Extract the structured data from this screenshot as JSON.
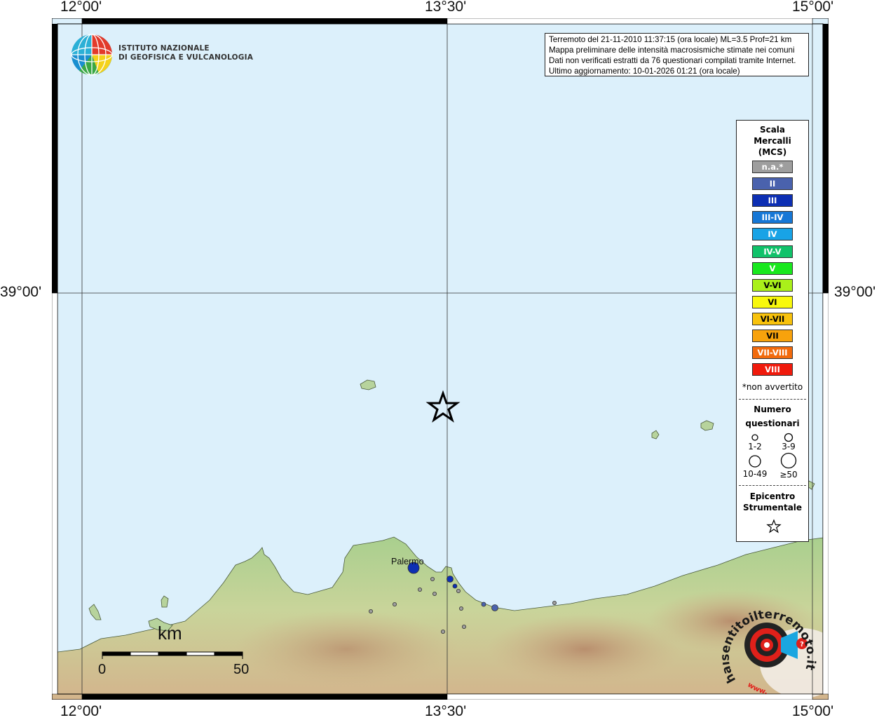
{
  "coords": {
    "top": [
      "12°00'",
      "13°30'",
      "15°00'"
    ],
    "bottom": [
      "12°00'",
      "13°30'",
      "15°00'"
    ],
    "left": "39°00'",
    "right": "39°00'"
  },
  "logo": {
    "line1": "ISTITUTO NAZIONALE",
    "line2": "DI GEOFISICA E VULCANOLOGIA"
  },
  "info": [
    "Terremoto del 21-11-2010 11:37:15 (ora locale) ML=3.5 Prof=21 km",
    "Mappa preliminare delle intensità macrosismiche stimate nei comuni",
    "Dati non verificati estratti da 76 questionari compilati tramite Internet.",
    "Ultimo aggiornamento: 10-01-2026 01:21 (ora locale)"
  ],
  "legend": {
    "title": [
      "Scala",
      "Mercalli",
      "(MCS)"
    ],
    "levels": [
      {
        "label": "n.a.*",
        "color": "#9e9e9e"
      },
      {
        "label": "II",
        "color": "#4a62ad"
      },
      {
        "label": "III",
        "color": "#0d2fb3"
      },
      {
        "label": "III-IV",
        "color": "#1677d6"
      },
      {
        "label": "IV",
        "color": "#18a3e6"
      },
      {
        "label": "IV-V",
        "color": "#10c26a"
      },
      {
        "label": "V",
        "color": "#19e81e"
      },
      {
        "label": "V-VI",
        "color": "#aaf01a"
      },
      {
        "label": "VI",
        "color": "#f8f80c"
      },
      {
        "label": "VI-VII",
        "color": "#f8c20c"
      },
      {
        "label": "VII",
        "color": "#f8a20c"
      },
      {
        "label": "VII-VIII",
        "color": "#f26a0c"
      },
      {
        "label": "VIII",
        "color": "#f01a0c"
      }
    ],
    "footnote": "*non avvertito",
    "count_title": [
      "Numero",
      "questionari"
    ],
    "counts": [
      "1-2",
      "3-9",
      "10-49",
      "≥50"
    ],
    "epicenter_title": [
      "Epicentro",
      "Strumentale"
    ]
  },
  "place": {
    "palermo": "Palermo"
  },
  "scale": {
    "unit": "km",
    "min": "0",
    "max": "50"
  },
  "badge": {
    "text": "haisentitoilterremoto.it",
    "url": "www."
  }
}
